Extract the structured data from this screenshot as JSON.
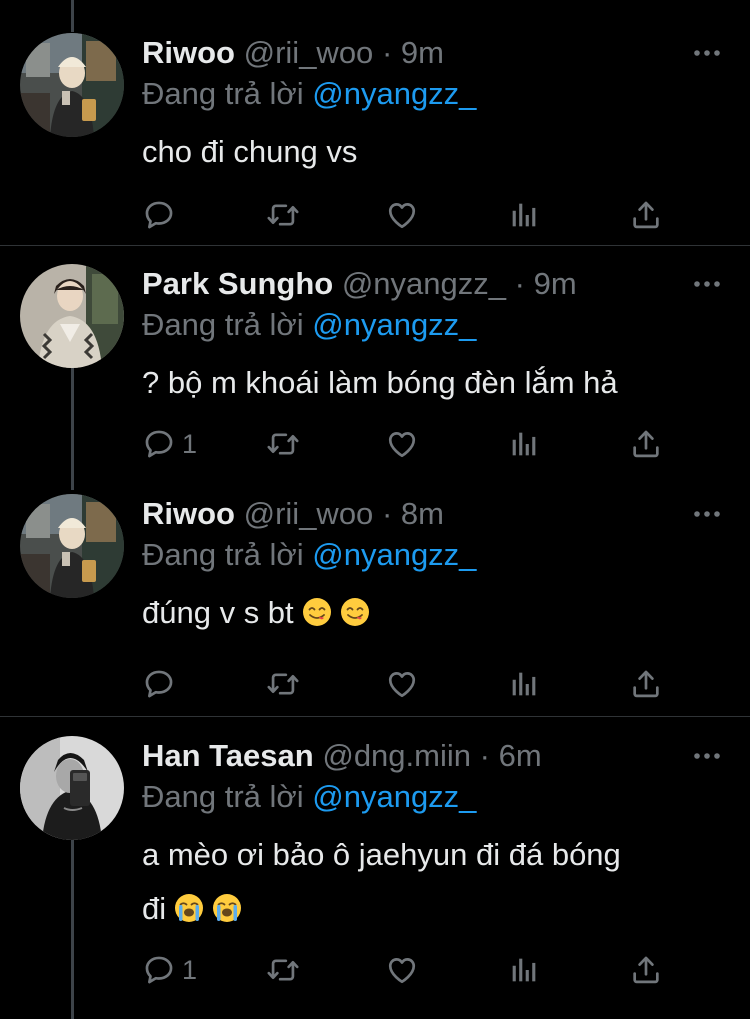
{
  "colors": {
    "background": "#000000",
    "text_primary": "#e7e9ea",
    "text_secondary": "#71767b",
    "mention": "#1d9bf0",
    "divider": "#2f3336",
    "thread_line": "#3d4349"
  },
  "tweets": [
    {
      "name": "Riwoo",
      "handle": "@rii_woo",
      "separator": "·",
      "time": "9m",
      "replying_prefix": "Đang trả lời",
      "replying_to": "@nyangzz_",
      "text": "cho đi chung vs",
      "emojis": [],
      "reply_count": "",
      "avatar_icon": "avatar-photo"
    },
    {
      "name": "Park Sungho",
      "handle": "@nyangzz_",
      "separator": "·",
      "time": "9m",
      "replying_prefix": "Đang trả lời",
      "replying_to": "@nyangzz_",
      "text": "? bộ m khoái làm bóng đèn lắm hả",
      "emojis": [],
      "reply_count": "1",
      "avatar_icon": "avatar-photo"
    },
    {
      "name": "Riwoo",
      "handle": "@rii_woo",
      "separator": "·",
      "time": "8m",
      "replying_prefix": "Đang trả lời",
      "replying_to": "@nyangzz_",
      "text": "đúng v s bt",
      "emojis": [
        "yum-emoji",
        "yum-emoji"
      ],
      "reply_count": "",
      "avatar_icon": "avatar-photo"
    },
    {
      "name": "Han Taesan",
      "handle": "@dng.miin",
      "separator": "·",
      "time": "6m",
      "replying_prefix": "Đang trả lời",
      "replying_to": "@nyangzz_",
      "text_line1": "a mèo ơi bảo ô jaehyun đi đá bóng",
      "text_line2": "đi",
      "emojis": [
        "loudly-crying-emoji",
        "loudly-crying-emoji"
      ],
      "reply_count": "1",
      "avatar_icon": "avatar-photo"
    }
  ],
  "action_icons": [
    "reply-icon",
    "retweet-icon",
    "like-icon",
    "analytics-icon",
    "share-icon"
  ]
}
